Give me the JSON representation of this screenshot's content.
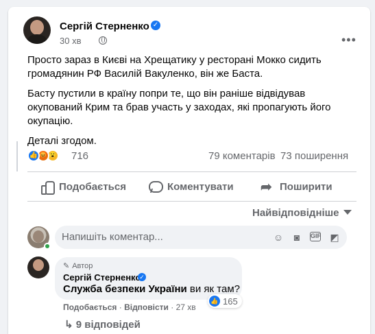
{
  "post": {
    "author": "Сергій Стерненко",
    "time": "30 хв",
    "more": "•••",
    "paragraphs": [
      "Просто зараз в Києві на Хрещатику у ресторані Мокко сидить громадянин РФ Василій Вакуленко, він же Баста.",
      "Басту пустили в країну попри те, що він раніше відвідував окупований Крим та брав участь у заходах, які пропагують його окупацію.",
      "Деталі згодом."
    ]
  },
  "stats": {
    "reactions": "716",
    "comments": "79 коментарів",
    "shares": "73 поширення"
  },
  "actions": {
    "like": "Подобається",
    "comment": "Коментувати",
    "share": "Поширити"
  },
  "sort": {
    "label": "Найвідповідніше"
  },
  "composer": {
    "placeholder": "Напишіть коментар..."
  },
  "comment": {
    "author_tag": "Автор",
    "author": "Сергій Стерненко",
    "mention": "Служба безпеки України",
    "text_rest": " ви як там?",
    "likes": "165",
    "like_label": "Подобається",
    "reply_label": "Відповісти",
    "time": "27 хв",
    "replies": "9 відповідей"
  },
  "colors": {
    "accent": "#1877f2",
    "muted": "#65676b",
    "background": "#f0f2f5",
    "online": "#31a24c"
  }
}
